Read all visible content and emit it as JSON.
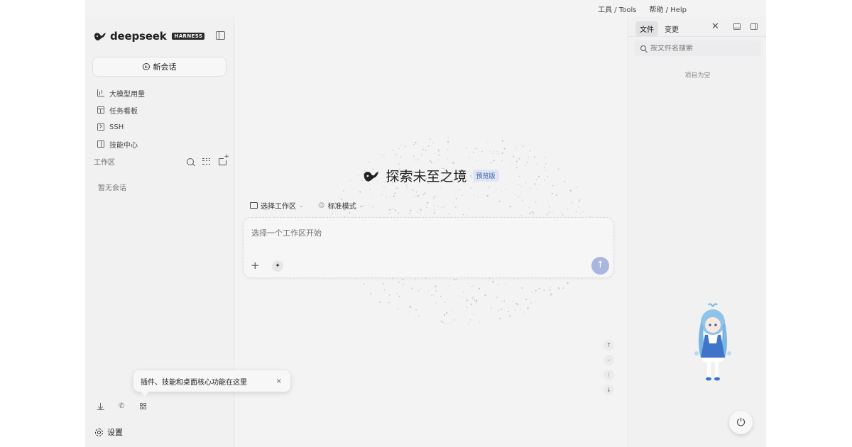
{
  "top_menu": {
    "tools": "工具 / Tools",
    "help": "帮助 / Help"
  },
  "brand": {
    "name": "deepseek",
    "badge": "HARNESS",
    "logo_icon": "whale-icon"
  },
  "sidebar": {
    "new_chat_label": "新会话",
    "nav_items": [
      {
        "label": "大模型用量",
        "icon": "bar-chart-icon"
      },
      {
        "label": "任务看板",
        "icon": "kanban-icon"
      },
      {
        "label": "SSH",
        "icon": "terminal-icon"
      },
      {
        "label": "技能中心",
        "icon": "book-icon"
      }
    ],
    "workspace_title": "工作区",
    "empty_chats": "暂无会话",
    "settings_label": "设置"
  },
  "tooltip": {
    "text": "插件、技能和桌面核心功能在这里",
    "close": "×"
  },
  "main": {
    "hero_title": "探索未至之境",
    "preview_badge": "预览版",
    "workspace_selector": "选择工作区",
    "mode_selector": "标准模式",
    "composer_placeholder": "选择一个工作区开始",
    "send_icon": "↑"
  },
  "right_panel": {
    "tabs": [
      {
        "label": "文件",
        "active": true
      },
      {
        "label": "变更",
        "active": false
      }
    ],
    "search_placeholder": "按文件名搜索",
    "empty_text": "项目为空"
  },
  "colors": {
    "accent": "#a9b7e0",
    "badge_bg": "#dfe6f3",
    "badge_text": "#3a5ea8",
    "app_bg": "#f3f3f4"
  }
}
